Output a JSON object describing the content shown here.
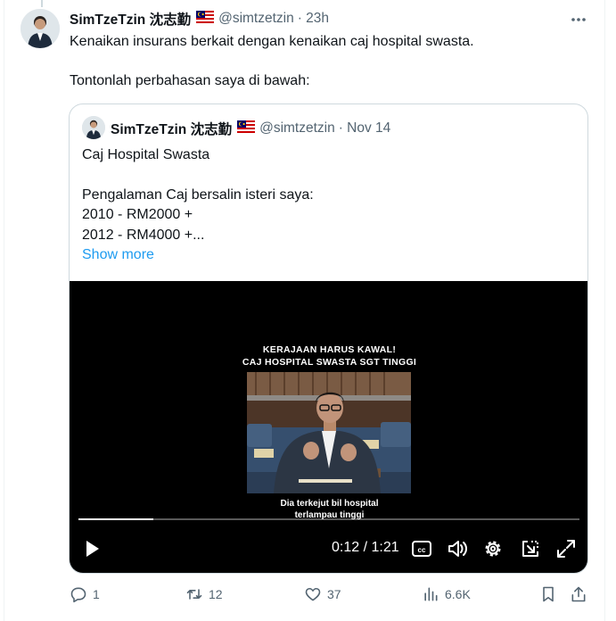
{
  "post": {
    "author": "SimTzeTzin 沈志勤",
    "handle": "@simtzetzin",
    "time": "· 23h",
    "text_line1": "Kenaikan insurans berkait dengan kenaikan caj hospital swasta.",
    "text_line2": "Tontonlah perbahasan saya di bawah:"
  },
  "quoted": {
    "author": "SimTzeTzin 沈志勤",
    "handle": "@simtzetzin",
    "time": "· Nov 14",
    "lines": [
      "Caj Hospital Swasta",
      "Pengalaman Caj bersalin isteri saya:",
      "2010 - RM2000 +",
      "2012 - RM4000 +..."
    ],
    "show_more": "Show more"
  },
  "video": {
    "caption_line1": "KERAJAAN HARUS KAWAL!",
    "caption_line2": "CAJ HOSPITAL SWASTA SGT TINGGI",
    "subtitle_line1": "Dia terkejut bil hospital",
    "subtitle_line2": "terlampau tinggi",
    "current_time": "0:12",
    "duration": "1:21",
    "time_display": "0:12 / 1:21",
    "progress_fraction": 0.15
  },
  "actions": {
    "replies": "1",
    "reposts": "12",
    "likes": "37",
    "views": "6.6K"
  },
  "icons": {
    "more": "more-horizontal-icon",
    "flag": "malaysia-flag-icon",
    "reply": "reply-icon",
    "repost": "repost-icon",
    "like": "heart-icon",
    "views": "views-icon",
    "bookmark": "bookmark-icon",
    "share": "share-icon",
    "play": "play-icon",
    "captions": "captions-icon",
    "volume": "volume-icon",
    "settings": "settings-icon",
    "pip": "picture-in-picture-icon",
    "fullscreen": "fullscreen-icon"
  },
  "colors": {
    "text": "#0f1419",
    "muted": "#536471",
    "link": "#1d9bf0",
    "border": "#cfd9de"
  }
}
